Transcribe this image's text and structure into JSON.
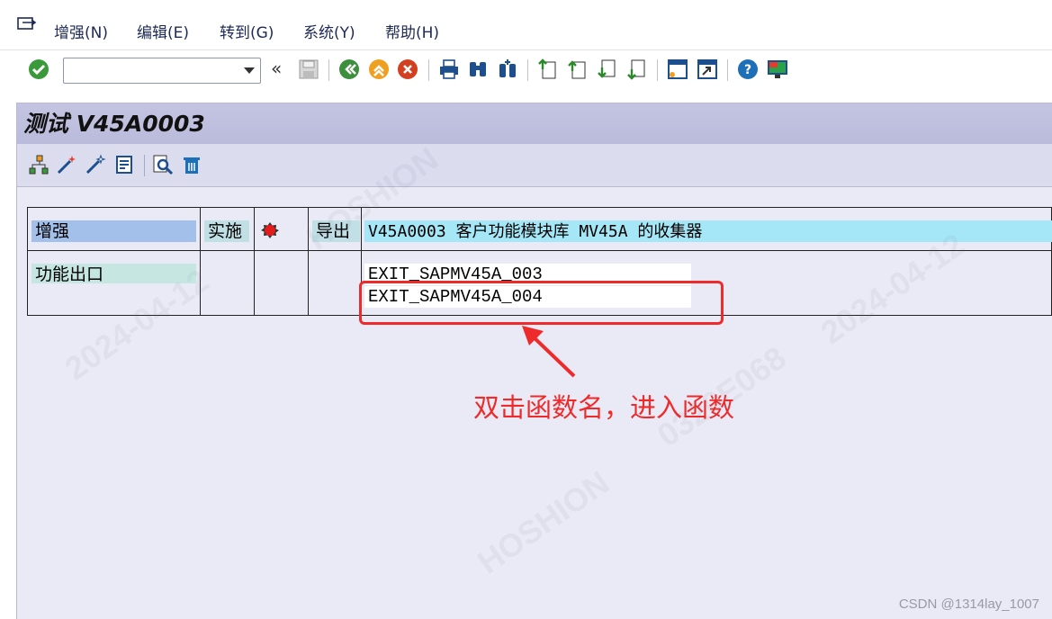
{
  "menu": {
    "items": [
      {
        "label": "增强(N)"
      },
      {
        "label": "编辑(E)"
      },
      {
        "label": "转到(G)"
      },
      {
        "label": "系统(Y)"
      },
      {
        "label": "帮助(H)"
      }
    ]
  },
  "toolbar": {
    "command_field_value": "",
    "back_double_label": "«"
  },
  "screen": {
    "title": "测试 V45A0003"
  },
  "table": {
    "header": {
      "enhancement": "增强",
      "implementation": "实施",
      "export": "导出",
      "description": "V45A0003 客户功能模块库 MV45A 的收集器"
    },
    "row": {
      "type": "功能出口",
      "functions": [
        "EXIT_SAPMV45A_003",
        "EXIT_SAPMV45A_004"
      ]
    }
  },
  "annotation": {
    "text": "双击函数名，进入函数",
    "color": "#ef2a2a"
  },
  "watermark": {
    "texts": [
      "HOSHION",
      "2024-04-12",
      "0320E068"
    ]
  },
  "credit": "CSDN @1314lay_1007",
  "colors": {
    "title_bar": "#c4c4e2",
    "panel_bg": "#eaeaf6",
    "enhancement_cell": "#a2c0ea",
    "description_cell": "#a5e7f6",
    "status_red": "#e21b1b"
  }
}
